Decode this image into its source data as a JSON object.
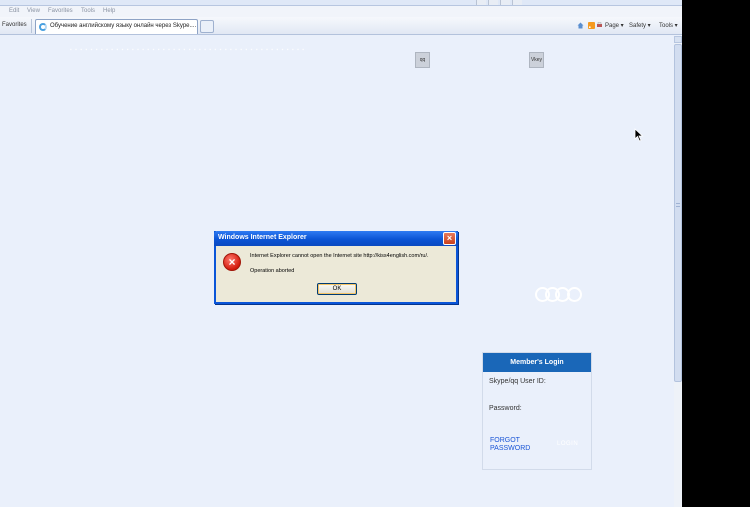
{
  "menu": {
    "items": [
      "Edit",
      "View",
      "Favorites",
      "Tools",
      "Help"
    ]
  },
  "favorites_bar": {
    "label": "Favorites"
  },
  "tab": {
    "title": "Обучение английскому языку онлайн через Skype...."
  },
  "command_bar": {
    "page": "Page",
    "safety": "Safety",
    "tools": "Tools"
  },
  "page": {
    "nav_text": "▪ ▪ ▪ ▪ ▪ ▪ ▪ ▪ ▪ ▪ ▪ ▪ ▪ ▪ ▪ ▪ ▪ ▪ ▪ ▪ ▪ ▪ ▪ ▪ ▪ ▪ ▪ ▪ ▪ ▪ ▪ ▪ ▪ ▪ ▪ ▪ ▪ ▪ ▪ ▪ ▪ ▪ ▪ ▪ ▪ ▪",
    "mini_buttons": [
      "qq",
      "Vkey"
    ]
  },
  "member_login": {
    "header": "Member's Login",
    "user_id_label": "Skype/qq User ID:",
    "password_label": "Password:",
    "forgot_line1": "FORGOT",
    "forgot_line2": "PASSWORD",
    "login_link": "LOGIN"
  },
  "dialog": {
    "title": "Windows Internet Explorer",
    "message": "Internet Explorer cannot open the Internet site http://kiss4english.com/ru/.",
    "submessage": "Operation aborted",
    "ok_label": "OK"
  },
  "colors": {
    "login_header": "#1a67b8",
    "dialog_title": "#0b54d5",
    "page_background": "#eaf0fb"
  }
}
